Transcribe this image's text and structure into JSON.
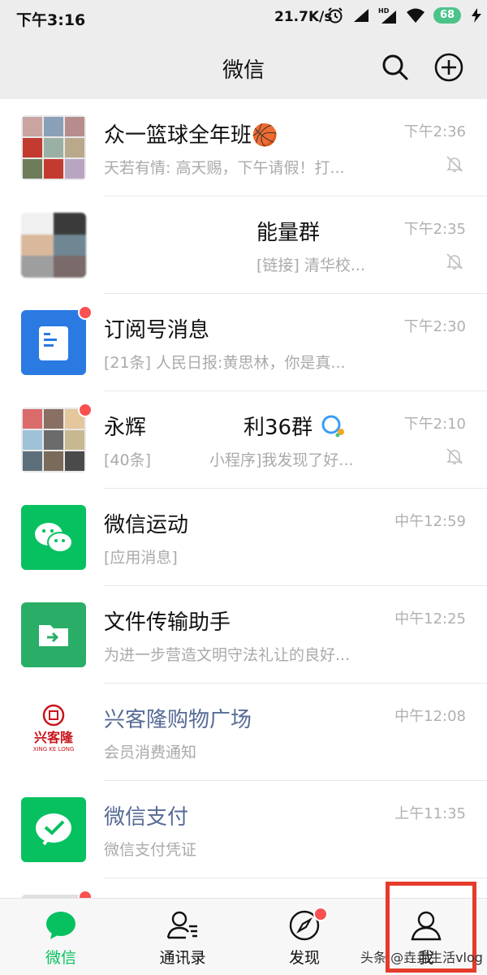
{
  "status_bar": {
    "time": "下午3:16",
    "net_speed": "21.7K/s",
    "battery": "68",
    "icons": [
      "alarm-icon",
      "signal-icon",
      "hd-signal-icon",
      "wifi-icon",
      "battery-icon",
      "charging-icon"
    ]
  },
  "nav": {
    "title": "微信",
    "search_icon": "search-icon",
    "add_icon": "plus-circle-icon"
  },
  "chats": [
    {
      "name": "众一篮球全年班🏀",
      "preview": "天若有情: 高天赐，下午请假！打...",
      "time": "下午2:36",
      "muted": true,
      "unread_dot": false
    },
    {
      "name": "能量群",
      "preview": "[链接] 清华校...",
      "time": "下午2:35",
      "muted": true,
      "unread_dot": false
    },
    {
      "name": "订阅号消息",
      "preview": "[21条] 人民日报:黄思林，你是真...",
      "time": "下午2:30",
      "muted": false,
      "unread_dot": true
    },
    {
      "name": "永辉",
      "name_suffix": "利36群",
      "preview_prefix": "[40条]",
      "preview": "小程序]我发现了好...",
      "time": "下午2:10",
      "muted": true,
      "unread_dot": true
    },
    {
      "name": "微信运动",
      "preview": "[应用消息]",
      "time": "中午12:59",
      "muted": false,
      "unread_dot": false
    },
    {
      "name": "文件传输助手",
      "preview": "为进一步营造文明守法礼让的良好...",
      "time": "中午12:25",
      "muted": false,
      "unread_dot": false
    },
    {
      "name": "兴客隆购物广场",
      "preview": "会员消费通知",
      "time": "中午12:08",
      "muted": false,
      "unread_dot": false,
      "logo_text": "兴客隆",
      "logo_sub": "XING KE LONG"
    },
    {
      "name": "微信支付",
      "preview": "微信支付凭证",
      "time": "上午11:35",
      "muted": false,
      "unread_dot": false
    }
  ],
  "tabs": [
    {
      "label": "微信",
      "icon": "chat-bubble-icon",
      "active": true
    },
    {
      "label": "通讯录",
      "icon": "contacts-icon",
      "active": false
    },
    {
      "label": "发现",
      "icon": "compass-icon",
      "active": false,
      "badge_dot": true
    },
    {
      "label": "我",
      "icon": "person-icon",
      "active": false
    }
  ],
  "colors": {
    "accent_green": "#07c160",
    "unread_red": "#fa5151",
    "highlight_box": "#e53b2c",
    "official_blue": "#576b95"
  },
  "watermark": "头条 @垚垚生活vlog"
}
